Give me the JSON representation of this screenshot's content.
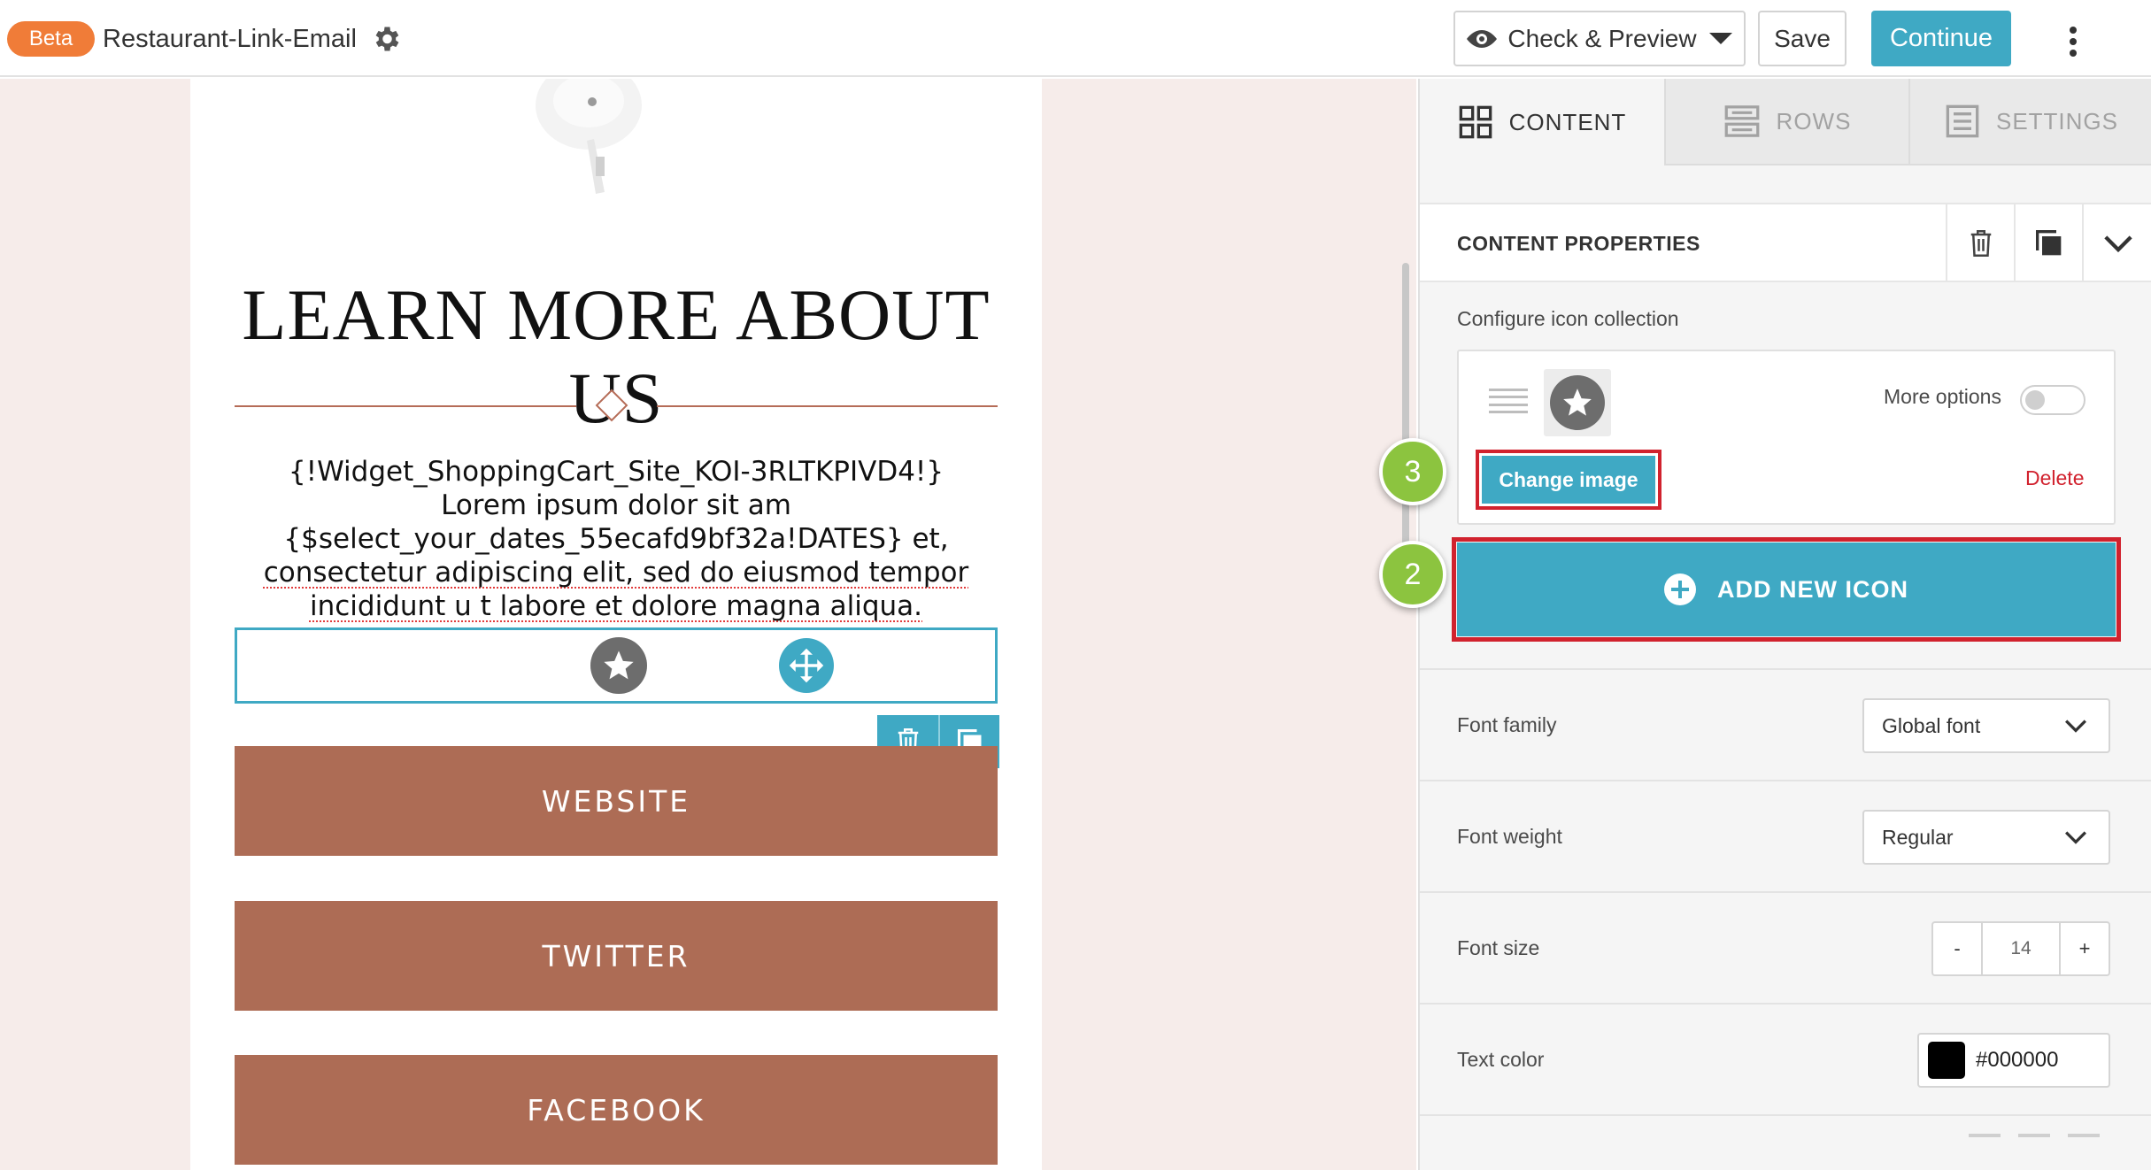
{
  "header": {
    "beta_label": "Beta",
    "title": "Restaurant-Link-Email",
    "preview_label": "Check & Preview",
    "save_label": "Save",
    "continue_label": "Continue"
  },
  "email": {
    "headline": "LEARN MORE ABOUT US",
    "body_lines": [
      "{!Widget_ShoppingCart_Site_KOI-3RLTKPIVD4!}",
      "Lorem ipsum dolor sit am",
      "{$select_your_dates_55ecafd9bf32a!DATES} et,",
      "consectetur adipiscing elit, sed do eiusmod tempor",
      "incididunt u t labore et dolore magna aliqua."
    ],
    "buttons": [
      "WEBSITE",
      "TWITTER",
      "FACEBOOK"
    ]
  },
  "panel": {
    "tabs": [
      "CONTENT",
      "ROWS",
      "SETTINGS"
    ],
    "active_tab": "CONTENT",
    "properties_title": "CONTENT PROPERTIES",
    "configure_label": "Configure icon collection",
    "more_options_label": "More options",
    "more_options_enabled": false,
    "change_image_label": "Change image",
    "delete_label": "Delete",
    "add_icon_label": "ADD NEW ICON",
    "font_family": {
      "label": "Font family",
      "value": "Global font"
    },
    "font_weight": {
      "label": "Font weight",
      "value": "Regular"
    },
    "font_size": {
      "label": "Font size",
      "value": "14",
      "minus": "-",
      "plus": "+"
    },
    "text_color": {
      "label": "Text color",
      "value": "#000000"
    }
  },
  "steps": {
    "add_icon": "2",
    "change_image": "3"
  },
  "colors": {
    "accent": "#3fa9c4",
    "beta": "#f07c38",
    "email_button": "#ad6c55",
    "highlight": "#d1222e",
    "step_marker": "#8cc43f"
  },
  "icons": [
    "gear-icon",
    "eye-icon",
    "kebab-icon",
    "star-icon",
    "move-icon",
    "trash-icon",
    "duplicate-icon",
    "grid-icon",
    "rows-icon",
    "settings-icon",
    "chevron-down-icon",
    "drag-handle-icon",
    "plus-circle-icon"
  ]
}
